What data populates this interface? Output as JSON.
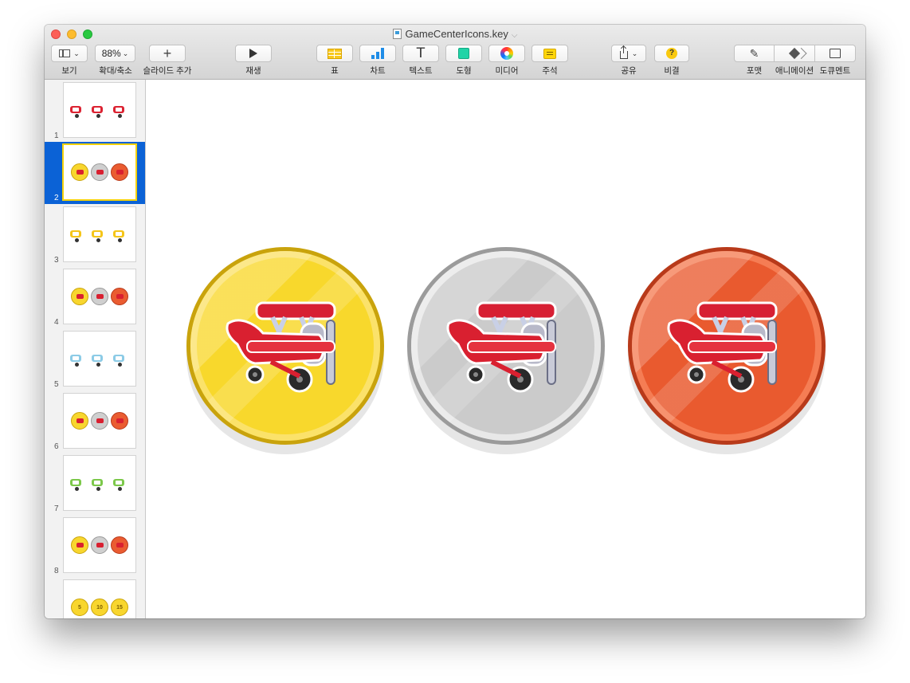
{
  "window": {
    "title": "GameCenterIcons.key"
  },
  "toolbar": {
    "view_label": "보기",
    "zoom_value": "88%",
    "zoom_label": "확대/축소",
    "add_slide_label": "슬라이드 추가",
    "play_label": "재생",
    "table_label": "표",
    "chart_label": "차트",
    "text_label": "텍스트",
    "shape_label": "도형",
    "media_label": "미디어",
    "comment_label": "주석",
    "share_label": "공유",
    "tips_label": "비결",
    "format_label": "포맷",
    "animate_label": "애니메이션",
    "document_label": "도큐멘트"
  },
  "navigator": {
    "selected_index": 2,
    "slides": [
      {
        "number": "1",
        "style": "planes-red"
      },
      {
        "number": "2",
        "style": "medals-red"
      },
      {
        "number": "3",
        "style": "planes-yellow"
      },
      {
        "number": "4",
        "style": "medals-yellow"
      },
      {
        "number": "5",
        "style": "planes-blue"
      },
      {
        "number": "6",
        "style": "medals-blue"
      },
      {
        "number": "7",
        "style": "planes-green"
      },
      {
        "number": "8",
        "style": "medals-green"
      },
      {
        "number": "",
        "style": "number-medals",
        "labels": [
          "5",
          "10",
          "15"
        ]
      }
    ]
  },
  "canvas": {
    "medals": [
      {
        "tier": "gold",
        "icon": "red-biplane-icon"
      },
      {
        "tier": "silver",
        "icon": "red-biplane-icon"
      },
      {
        "tier": "bronze",
        "icon": "red-biplane-icon"
      }
    ]
  },
  "colors": {
    "selection": "#0b62d6",
    "gold": "#f7d62f",
    "silver": "#d1d1d1",
    "bronze": "#ea5c31",
    "plane_red": "#d92030"
  }
}
